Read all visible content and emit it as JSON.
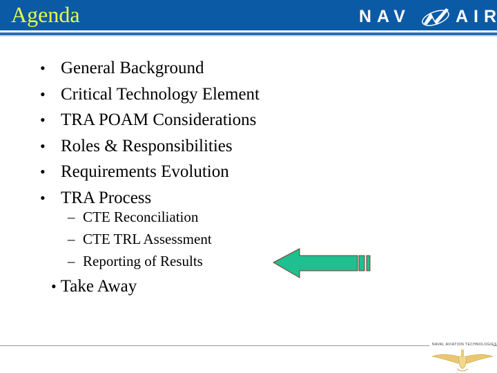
{
  "header": {
    "title": "Agenda",
    "logo_text_left": "NAV",
    "logo_text_right": "AIR",
    "colors": {
      "band": "#0b5aa6",
      "title": "#e6ff4a"
    }
  },
  "bullets": [
    {
      "marker": "•",
      "label": "General Background"
    },
    {
      "marker": "•",
      "label": "Critical Technology Element"
    },
    {
      "marker": "•",
      "label": "TRA POAM Considerations"
    },
    {
      "marker": "•",
      "label": "Roles & Responsibilities"
    },
    {
      "marker": "•",
      "label": "Requirements Evolution"
    },
    {
      "marker": "•",
      "label": "TRA Process"
    }
  ],
  "sub_bullets": [
    {
      "marker": "–",
      "label": "CTE Reconciliation"
    },
    {
      "marker": "–",
      "label": "CTE TRL Assessment"
    },
    {
      "marker": "–",
      "label": "Reporting of Results"
    }
  ],
  "final_bullet": {
    "marker": "•",
    "label": "Take Away"
  },
  "pointer": {
    "icon": "left-arrow-icon",
    "color": "#1fbf8f",
    "points_to": "Reporting of Results"
  },
  "footer": {
    "text": "NAVAL AVIATION TECHNOLOGIES",
    "emblem": "naval-aviator-wings-icon"
  }
}
